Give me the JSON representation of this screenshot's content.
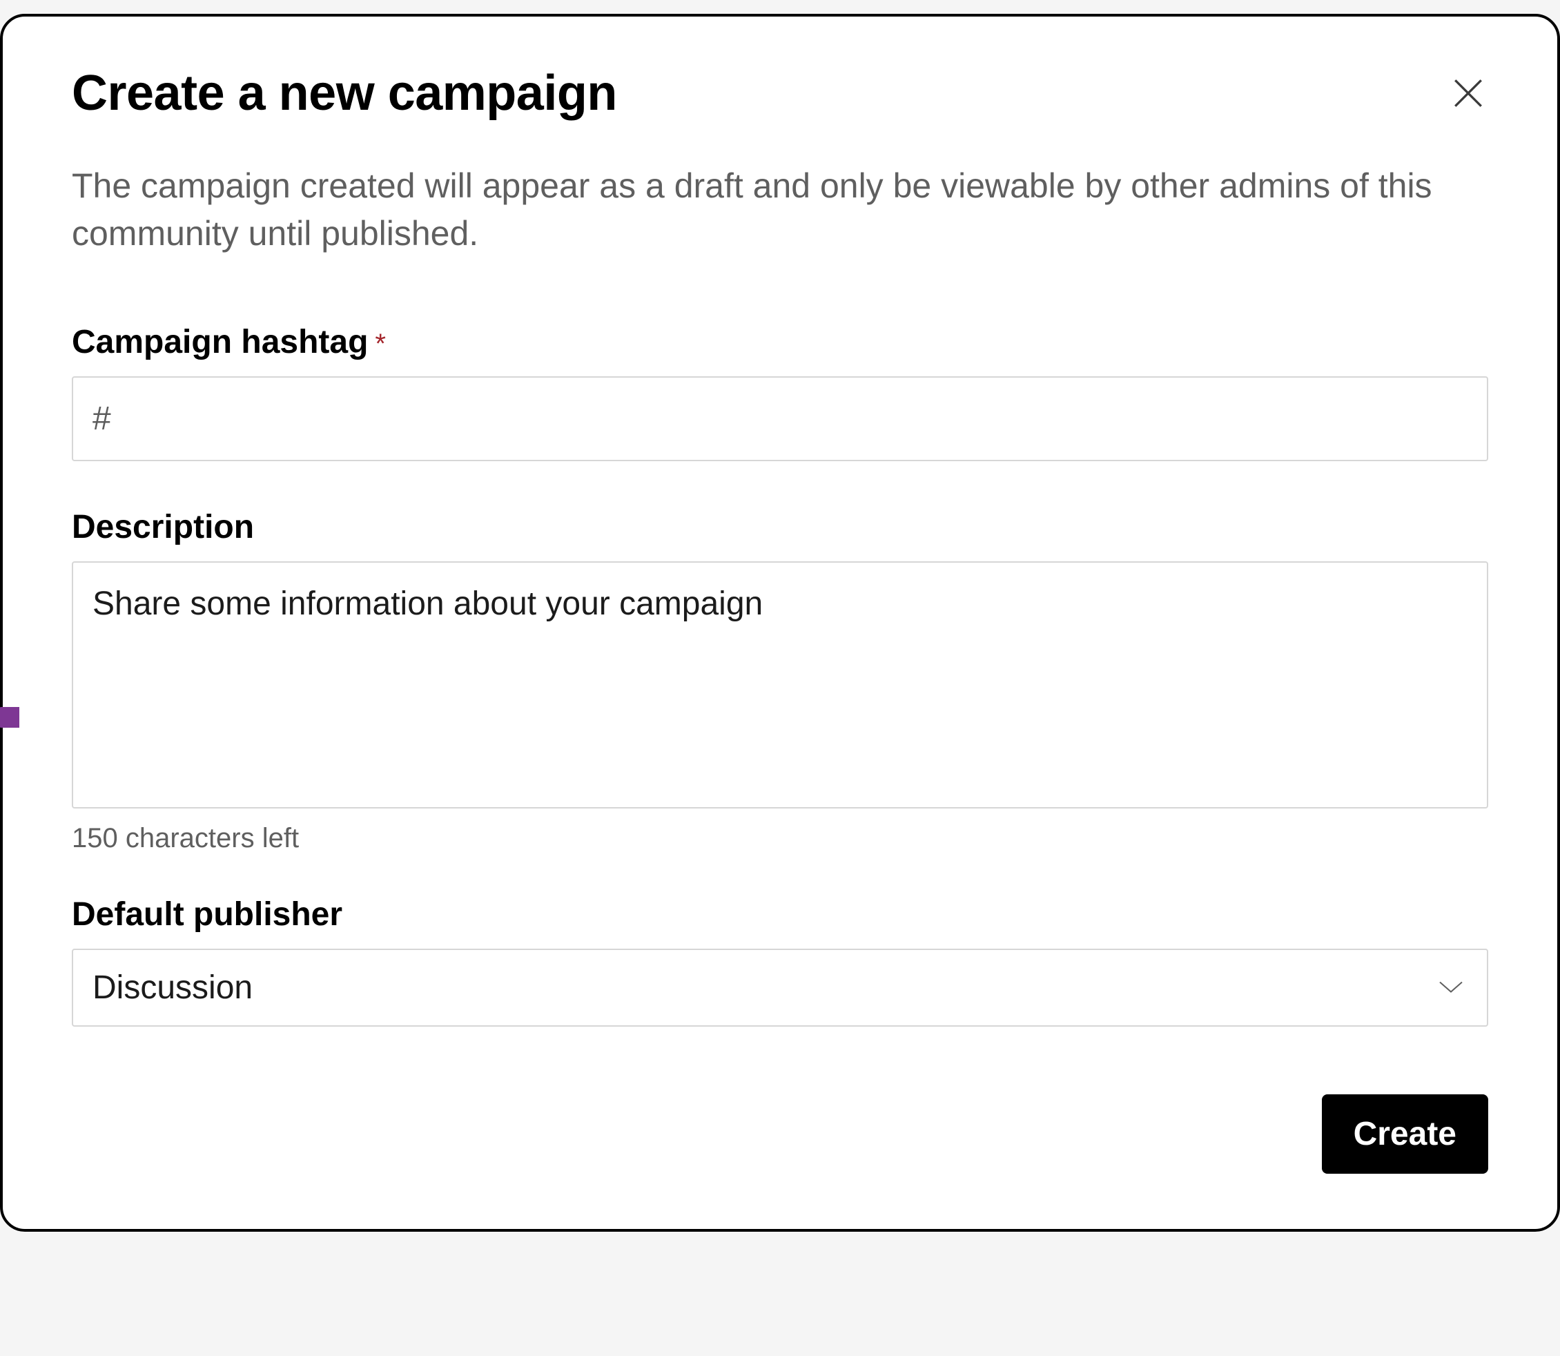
{
  "modal": {
    "title": "Create a new campaign",
    "description": "The campaign created will appear as a draft and only be viewable by other admins of this community until published."
  },
  "form": {
    "hashtag": {
      "label": "Campaign hashtag",
      "required_marker": "*",
      "value": "#",
      "placeholder": ""
    },
    "description": {
      "label": "Description",
      "placeholder": "Share some information about your campaign",
      "value": "",
      "counter": "150 characters left"
    },
    "publisher": {
      "label": "Default publisher",
      "selected": "Discussion"
    }
  },
  "actions": {
    "create": "Create"
  }
}
